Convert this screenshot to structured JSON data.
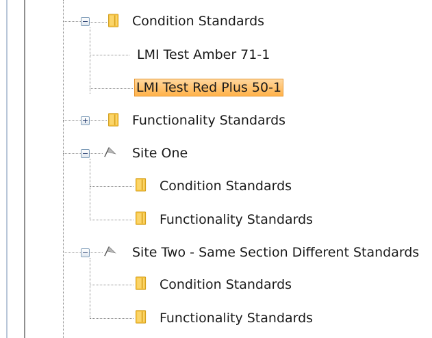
{
  "tree": {
    "nodes": [
      {
        "label": "Condition Standards",
        "expander": "collapse",
        "icon": "folder-icon"
      },
      {
        "label": "LMI Test Amber 71-1"
      },
      {
        "label": "LMI Test Red Plus 50-1",
        "selected": true
      },
      {
        "label": "Functionality Standards",
        "expander": "expand",
        "icon": "folder-icon"
      },
      {
        "label": "Site One",
        "expander": "collapse",
        "icon": "flag-icon"
      },
      {
        "label": "Condition Standards",
        "icon": "folder-icon"
      },
      {
        "label": "Functionality Standards",
        "icon": "folder-icon"
      },
      {
        "label": "Site Two - Same Section Different Standards",
        "expander": "collapse",
        "icon": "flag-icon"
      },
      {
        "label": "Condition Standards",
        "icon": "folder-icon"
      },
      {
        "label": "Functionality Standards",
        "icon": "folder-icon"
      }
    ]
  },
  "colors": {
    "selection": "#ffb24a",
    "selection_border": "#e59631",
    "folder": "#f7c23c"
  }
}
